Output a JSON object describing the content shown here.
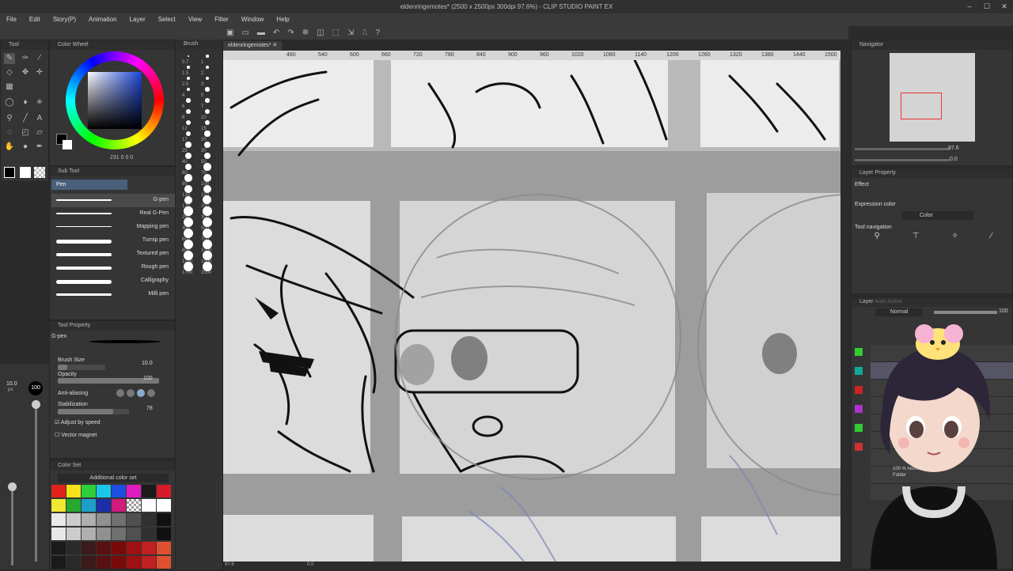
{
  "window": {
    "title": "eldenringemotes* (2500 x 2500px 300dpi 97.6%) - CLIP STUDIO PAINT EX"
  },
  "menu": [
    "File",
    "Edit",
    "Story(P)",
    "Animation",
    "Layer",
    "Select",
    "View",
    "Filter",
    "Window",
    "Help"
  ],
  "panels": {
    "tool": "Tool",
    "color_wheel": "Color Wheel",
    "color_values": "231  0  0  0",
    "sub_tool": "Sub Tool",
    "sub_tool_group": "Pen",
    "brush": "Brush",
    "tool_property": "Tool Property",
    "tool_property_brush": "G-pen",
    "color_set": "Color Set",
    "color_set_name": "Additional color set",
    "navigator": "Navigator",
    "nav_zoom": "97.6",
    "nav_angle": "0.0",
    "layer_property": "Layer Property",
    "layer_search": "Auto Action",
    "effect": "Effect",
    "expression_color": "Expression color",
    "expression_value": "Color",
    "tool_navigation": "Tool navigation",
    "layer": "Layer",
    "blend_mode": "Normal",
    "opacity": "100",
    "layer_normal_label": "100 % Normal",
    "layer_folder_label": "Folder"
  },
  "sub_tools": [
    {
      "name": "G-pen",
      "selected": true
    },
    {
      "name": "Real G-Pen"
    },
    {
      "name": "Mapping pen"
    },
    {
      "name": "Turnip pen"
    },
    {
      "name": "Textured pen"
    },
    {
      "name": "Rough pen"
    },
    {
      "name": "Calligraphy"
    },
    {
      "name": "Milli pen"
    }
  ],
  "tool_props": {
    "brush_size_label": "Brush Size",
    "brush_size": "10.0",
    "opacity_label": "Opacity",
    "opacity": "100",
    "anti_alias_label": "Anti-aliasing",
    "stabilization_label": "Stabilization",
    "stabilization": "78",
    "adjust_speed_label": "Adjust by speed",
    "vector_magnet_label": "Vector magnet"
  },
  "size_panel": {
    "size": "10.0",
    "unit": "px",
    "opacity": "100"
  },
  "brush_sizes": [
    "0.7",
    "1",
    "1.5",
    "2",
    "2.5",
    "3",
    "4",
    "5",
    "6",
    "7",
    "8",
    "10",
    "12",
    "15",
    "17",
    "20",
    "25",
    "30",
    "40",
    "50",
    "60",
    "70",
    "80",
    "100",
    "120",
    "150",
    "170",
    "200",
    "250",
    "300",
    "400",
    "500",
    "600",
    "700",
    "800",
    "1000",
    "1200",
    "1500",
    "1700",
    "2000"
  ],
  "ruler_ticks": [
    "480",
    "540",
    "600",
    "660",
    "720",
    "780",
    "840",
    "900",
    "960",
    "1020",
    "1080",
    "1140",
    "1200",
    "1260",
    "1320",
    "1380",
    "1440",
    "1500"
  ],
  "doc_tab": "eldenringemotes*",
  "status": {
    "zoom": "97.6",
    "angle": "0.0"
  },
  "colors": {
    "palette_row1": [
      "#e0211c",
      "#f5e21a",
      "#2fcf3a",
      "#19c8e8",
      "#1c4fe0",
      "#e01cc0",
      "#1a1a1a",
      "#d61c2a"
    ],
    "palette_row2": [
      "#f0e832",
      "#27a830",
      "#1aa0c8",
      "#1c2fa8",
      "#d01c7a",
      "#ffffff",
      "#ffffff",
      "#ffffff"
    ],
    "grays": [
      "#e8e8e8",
      "#cccccc",
      "#b0b0b0",
      "#909090",
      "#707070",
      "#505050",
      "#303030",
      "#111111"
    ],
    "reds": [
      "#1a1a1a",
      "#2a2a2a",
      "#3a1a1a",
      "#5a1010",
      "#7a0a0a",
      "#a01010",
      "#c02020",
      "#e05030"
    ]
  }
}
